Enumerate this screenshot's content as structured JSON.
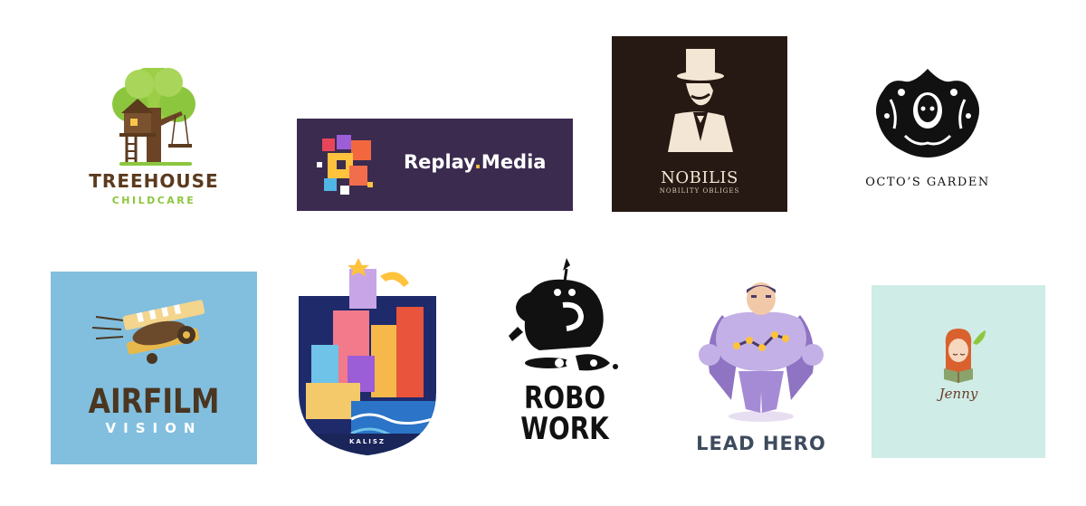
{
  "logos": {
    "treehouse": {
      "name": "TREEHOUSE",
      "sub": "CHILDCARE"
    },
    "replay": {
      "name_a": "Replay",
      "dot": ".",
      "name_b": "Media"
    },
    "nobilis": {
      "name": "NOBILIS",
      "sub": "NOBILITY OBLIGES"
    },
    "octo": {
      "name": "OCTO’S GARDEN"
    },
    "airfilm": {
      "name": "AIRFILM",
      "sub": "VISION"
    },
    "kalisz": {
      "name": "KALISZ"
    },
    "robo": {
      "line1": "ROBO",
      "line2": "WORK"
    },
    "leadhero": {
      "name": "LEAD HERO"
    },
    "jenny": {
      "name": "Jenny"
    }
  },
  "colors": {
    "background": "#ffffff",
    "replay_bg": "#3b2b4f",
    "nobilis_bg": "#261913",
    "airfilm_bg": "#82bfdf",
    "jenny_bg": "#cfece7",
    "treehouse_brown": "#5b3a1e",
    "treehouse_green": "#8cc63f"
  }
}
